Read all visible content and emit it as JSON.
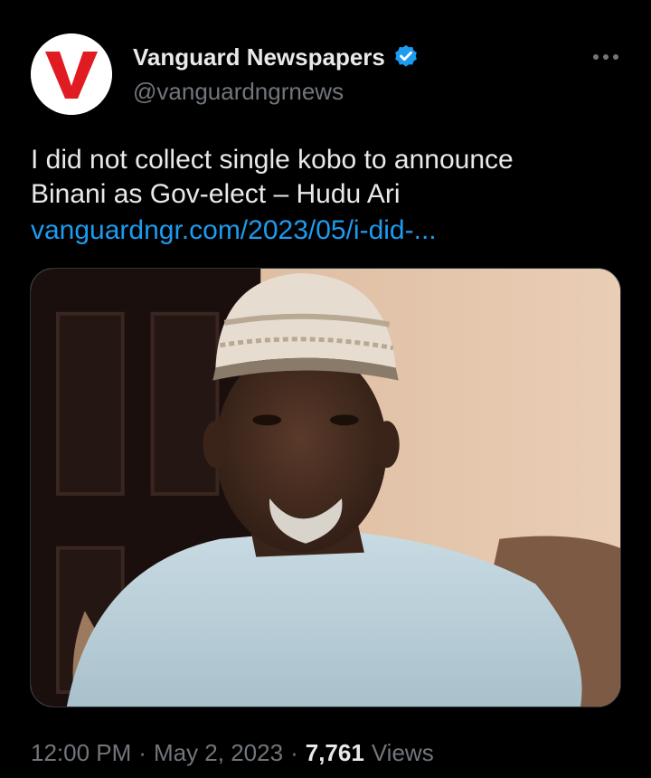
{
  "author": {
    "display_name": "Vanguard Newspapers",
    "handle": "@vanguardngrnews",
    "avatar_icon": "vanguard-v-logo",
    "avatar_letter": "V",
    "verified_icon": "verified-badge-icon",
    "brand_color": "#e11b22",
    "verified_color": "#1d9bf0"
  },
  "menu": {
    "icon": "more-dots-icon"
  },
  "tweet": {
    "text_lines": [
      "I did not collect single kobo to announce",
      "Binani as Gov-elect – Hudu Ari"
    ],
    "link_text": "vanguardngr.com/2023/05/i-did-..."
  },
  "media": {
    "kind": "photo"
  },
  "meta": {
    "time": "12:00 PM",
    "separator": "·",
    "date": "May 2, 2023",
    "views_count": "7,761",
    "views_label": "Views"
  }
}
